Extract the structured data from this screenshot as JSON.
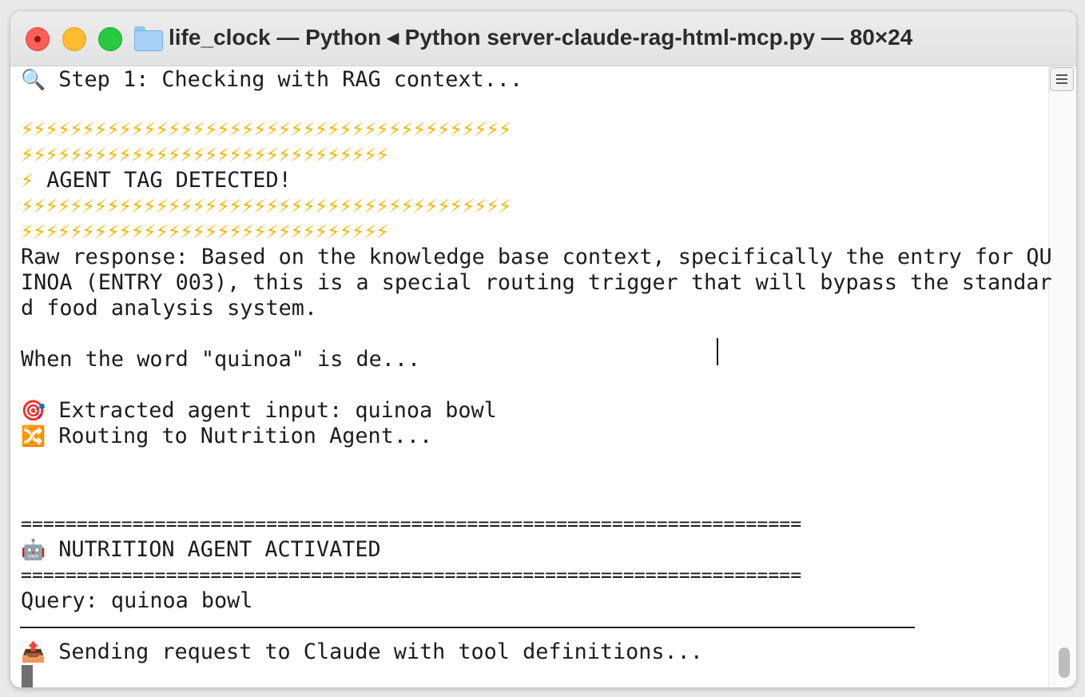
{
  "window": {
    "title": "life_clock — Python ◂ Python server-claude-rag-html-mcp.py — 80×24"
  },
  "colors": {
    "bolt": "#f2b600",
    "close": "#ff5f57",
    "minimize": "#febc2e",
    "maximize": "#28c840"
  },
  "terminal": {
    "step": {
      "icon": "🔍",
      "text": "Step 1: Checking with RAG context..."
    },
    "bolts_full": "⚡⚡⚡⚡⚡⚡⚡⚡⚡⚡⚡⚡⚡⚡⚡⚡⚡⚡⚡⚡⚡⚡⚡⚡⚡⚡⚡⚡⚡⚡⚡⚡⚡⚡⚡⚡⚡⚡⚡⚡",
    "bolts_partial": "⚡⚡⚡⚡⚡⚡⚡⚡⚡⚡⚡⚡⚡⚡⚡⚡⚡⚡⚡⚡⚡⚡⚡⚡⚡⚡⚡⚡⚡⚡",
    "agent_tag": {
      "icon": "⚡",
      "text": "AGENT TAG DETECTED!"
    },
    "raw_1": "Raw response: Based on the knowledge base context, specifically the entry for QU",
    "raw_2": "INOA (ENTRY 003), this is a special routing trigger that will bypass the standar",
    "raw_3": "d food analysis system.",
    "when": "When the word \"quinoa\" is de...",
    "extracted": {
      "icon": "🎯",
      "text": "Extracted agent input: quinoa bowl"
    },
    "routing": {
      "icon": "🔀",
      "text": "Routing to Nutrition Agent..."
    },
    "separator": "======================================================================",
    "activated": {
      "icon": "🤖",
      "text": "NUTRITION AGENT ACTIVATED"
    },
    "query": "Query: quinoa bowl",
    "sending": {
      "icon": "📤",
      "text": "Sending request to Claude with tool definitions..."
    }
  }
}
